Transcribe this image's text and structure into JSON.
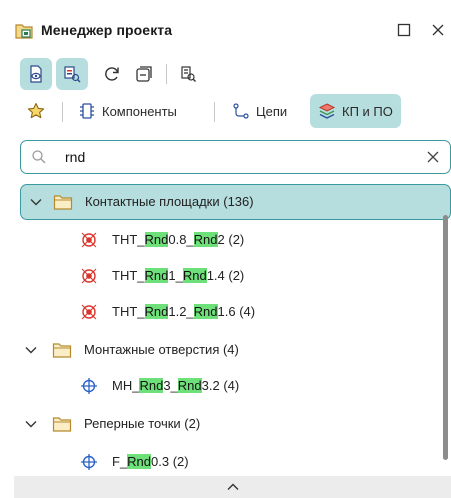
{
  "window": {
    "title": "Менеджер проекта",
    "icon": "project-manager-icon",
    "maximize_icon": "maximize-icon",
    "close_icon": "close-icon"
  },
  "toolbar": {
    "buttons": [
      {
        "icon": "view-eye-icon",
        "active": true
      },
      {
        "icon": "view-select-icon",
        "active": true
      },
      {
        "icon": "refresh-icon",
        "active": false
      },
      {
        "icon": "collapse-icon",
        "active": false
      },
      {
        "icon": "filter-icon",
        "active": false
      }
    ]
  },
  "tabs": {
    "favorites_icon": "star-icon",
    "items": [
      {
        "label": "Компоненты",
        "icon": "component-icon",
        "active": false
      },
      {
        "label": "Цепи",
        "icon": "net-icon",
        "active": false
      },
      {
        "label": "КП и ПО",
        "icon": "layers-icon",
        "active": true
      }
    ]
  },
  "search": {
    "value": "rnd",
    "placeholder": ""
  },
  "tree": {
    "groups": [
      {
        "label": "Контактные площадки (136)",
        "expanded": true,
        "selected": true,
        "items": [
          {
            "parts": [
              "THT_",
              "Rnd",
              "0.8_",
              "Rnd",
              "2 (2)"
            ],
            "icon": "pad-icon"
          },
          {
            "parts": [
              "THT_",
              "Rnd",
              "1_",
              "Rnd",
              "1.4 (2)"
            ],
            "icon": "pad-icon"
          },
          {
            "parts": [
              "THT_",
              "Rnd",
              "1.2_",
              "Rnd",
              "1.6 (4)"
            ],
            "icon": "pad-icon"
          }
        ]
      },
      {
        "label": "Монтажные отверстия (4)",
        "expanded": true,
        "selected": false,
        "items": [
          {
            "parts": [
              "MH_",
              "Rnd",
              "3_",
              "Rnd",
              "3.2 (4)"
            ],
            "icon": "crosshair-icon"
          }
        ]
      },
      {
        "label": "Реперные точки (2)",
        "expanded": true,
        "selected": false,
        "items": [
          {
            "parts": [
              "F_",
              "Rnd",
              "0.3 (2)"
            ],
            "icon": "crosshair-icon"
          }
        ]
      }
    ]
  },
  "colors": {
    "accent": "#3a9aa0",
    "active_bg": "#b7dede",
    "highlight": "#6ee07a",
    "pad_red": "#d9342b",
    "crosshair_blue": "#2b62c9",
    "folder": "#c9a24a"
  }
}
